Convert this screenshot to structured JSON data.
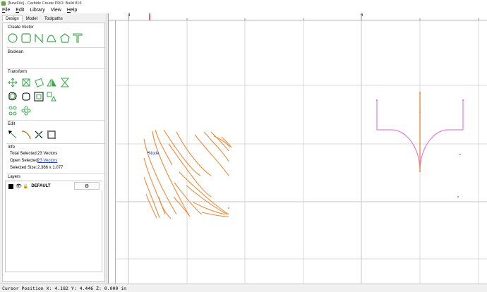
{
  "window": {
    "title": "[NewFile] - Carbide Create PRO: Build 816"
  },
  "menu": [
    {
      "key": "F",
      "rest": "ile"
    },
    {
      "key": "E",
      "rest": "dit"
    },
    {
      "key": "",
      "rest": "Library"
    },
    {
      "key": "",
      "rest": "View"
    },
    {
      "key": "H",
      "rest": "elp"
    }
  ],
  "tabs": [
    "Design",
    "Model",
    "Toolpaths"
  ],
  "sections": {
    "create_vector": "Create Vector",
    "boolean": "Boolean",
    "transform": "Transform",
    "edit": "Edit",
    "info": "Info",
    "layers": "Layers"
  },
  "info": {
    "total_selected_label": "Total Selected:",
    "total_selected_value": "23 Vectors",
    "open_selected_label": "Open Selected:",
    "open_selected_value": "23 Vectors",
    "selected_size_label": "Selected Size:",
    "selected_size_value": "2.366 x 1.077"
  },
  "layers": [
    {
      "name": "DEFAULT",
      "color": "#000000"
    }
  ],
  "ruler": {
    "top_labels": [
      "4",
      "6"
    ]
  },
  "canvas": {
    "node_label": "Node",
    "vector_color": "#f08a3c",
    "shape_color": "#e060e0",
    "grid_color": "#d9d9d9"
  },
  "icons": {
    "create_vector": [
      "circle-icon",
      "rectangle-icon",
      "polyline-icon",
      "curve-icon",
      "polygon-icon",
      "text-icon"
    ],
    "transform": [
      "move-icon",
      "align-icon",
      "rotate-icon",
      "mirror-icon",
      "scale-icon",
      "offset-icon",
      "fillet-icon",
      "array-icon",
      "align-shapes-icon",
      "circle-array-icon",
      "pattern-icon"
    ],
    "edit": [
      "node-edit-icon",
      "smooth-icon",
      "trim-icon",
      "select-icon"
    ]
  },
  "status": {
    "cursor_position": "Cursor Position X: 4.182 Y: 4.446 Z: 0.000 in"
  }
}
